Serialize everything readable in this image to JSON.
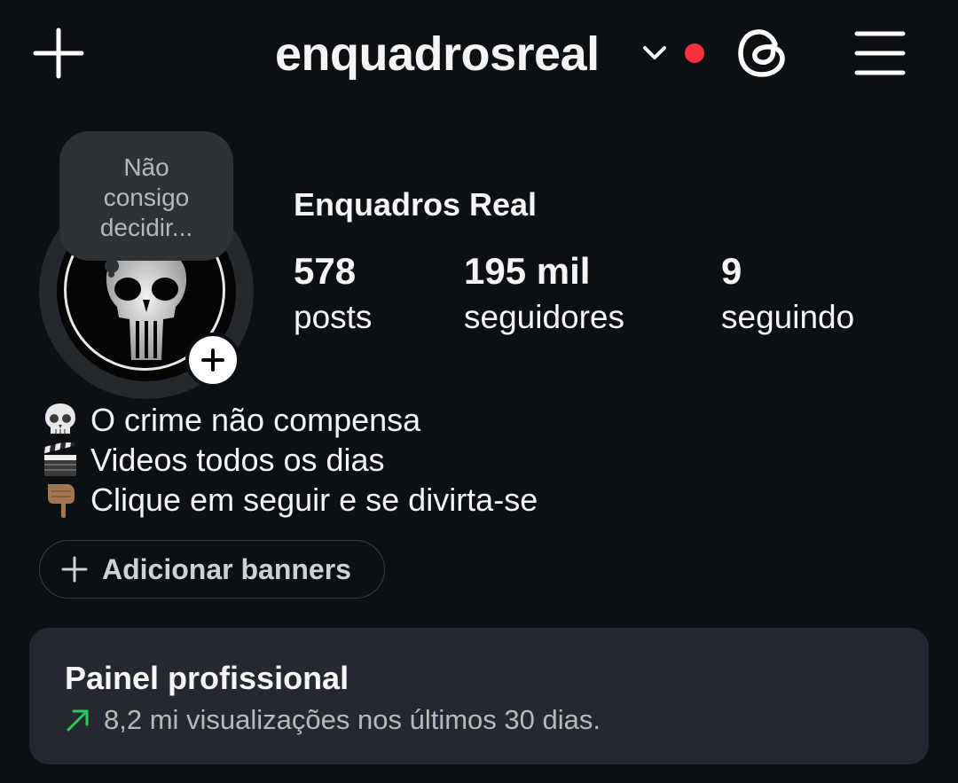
{
  "header": {
    "username": "enquadrosreal",
    "create_icon": "plus-icon",
    "switch_icon": "chevron-down-icon",
    "threads_icon": "threads-icon",
    "menu_icon": "hamburger-menu-icon",
    "notification_dot_color": "#ff3040"
  },
  "profile": {
    "note": [
      "Não",
      "consigo",
      "decidir..."
    ],
    "display_name": "Enquadros Real",
    "stats": [
      {
        "value": "578",
        "label": "posts"
      },
      {
        "value": "195 mil",
        "label": "seguidores"
      },
      {
        "value": "9",
        "label": "seguindo"
      }
    ]
  },
  "bio": [
    {
      "emoji": "skull-emoji",
      "text": "O crime não compensa"
    },
    {
      "emoji": "clapper-board-emoji",
      "text": "Videos todos os dias"
    },
    {
      "emoji": "pointing-down-emoji",
      "text": "Clique em seguir e se divirta-se"
    }
  ],
  "banner_button": {
    "label": "Adicionar banners"
  },
  "pro_panel": {
    "title": "Painel profissional",
    "subtitle": "8,2 mi visualizações nos últimos 30 dias.",
    "trend_color": "#2ec95c"
  }
}
